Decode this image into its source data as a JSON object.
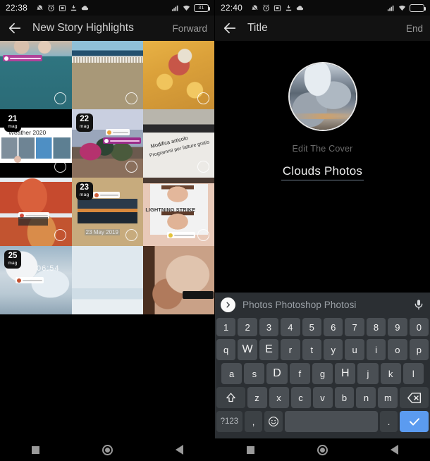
{
  "left": {
    "status": {
      "time": "22:38",
      "battery_text": "31",
      "icons": [
        "alarm-muted-icon",
        "alarm-icon",
        "screenshot-icon",
        "download-icon",
        "cloud-icon"
      ],
      "right_icons": [
        "signal-icon",
        "wifi-icon",
        "battery-icon"
      ]
    },
    "appbar": {
      "back": "back-arrow-icon",
      "title": "New Story Highlights",
      "action": "Forward"
    },
    "grid": [
      {
        "name": "cell-person-mask",
        "badge": null,
        "theme": "teal",
        "chip_text": "ROSSANO CALABRO",
        "selected": false
      },
      {
        "name": "cell-beach",
        "badge": null,
        "theme": "beach",
        "selected": false
      },
      {
        "name": "cell-food-meat",
        "badge": null,
        "theme": "food1",
        "selected": false
      },
      {
        "name": "cell-weather-2020",
        "badge": {
          "day": "21",
          "month": "mag"
        },
        "theme": "weather",
        "overlay": "Weather 2020",
        "selected": false
      },
      {
        "name": "cell-tree-street",
        "badge": {
          "day": "22",
          "month": "mag"
        },
        "theme": "tree",
        "selected": false
      },
      {
        "name": "cell-article-edit",
        "badge": null,
        "theme": "article",
        "overlay": "Modifica articolo",
        "overlay2": "Programmi per fatture gratis",
        "selected": false
      },
      {
        "name": "cell-pasta",
        "badge": null,
        "theme": "pasta",
        "selected": false
      },
      {
        "name": "cell-sunset-boat",
        "badge": {
          "day": "23",
          "month": "mag"
        },
        "theme": "sunset",
        "overlay": "23 May 2019",
        "selected": false
      },
      {
        "name": "cell-lightning-meme",
        "badge": null,
        "theme": "meme",
        "overlay": "LIGHTNING STRIKE",
        "selected": false
      },
      {
        "name": "cell-clouds-time",
        "badge": {
          "day": "25",
          "month": "mag"
        },
        "theme": "clouds",
        "overlay": "06:54",
        "selected": false
      },
      {
        "name": "cell-sky-plain",
        "badge": null,
        "theme": "sky",
        "selected": false
      },
      {
        "name": "cell-texture",
        "badge": null,
        "theme": "texture",
        "selected": false
      }
    ],
    "nav": {
      "recents": "square-icon",
      "home": "circle-icon",
      "back": "triangle-back-icon"
    }
  },
  "right": {
    "status": {
      "time": "22:40",
      "battery_text": "",
      "icons": [
        "alarm-muted-icon",
        "alarm-icon",
        "screenshot-icon",
        "download-icon",
        "cloud-icon"
      ],
      "right_icons": [
        "signal-icon",
        "wifi-icon",
        "battery-icon"
      ]
    },
    "appbar": {
      "back": "back-arrow-icon",
      "title": "Title",
      "action": "End"
    },
    "cover": {
      "edit_label": "Edit The Cover",
      "title_value": "Clouds Photos"
    },
    "keyboard": {
      "suggestions": "Photos Photoshop Photosi",
      "more_icon": "chevron-right-icon",
      "mic_icon": "microphone-icon",
      "row_numbers": [
        "1",
        "2",
        "3",
        "4",
        "5",
        "6",
        "7",
        "8",
        "9",
        "0"
      ],
      "row1": [
        "q",
        "W",
        "E",
        "r",
        "t",
        "y",
        "u",
        "i",
        "o",
        "p"
      ],
      "row2": [
        "a",
        "s",
        "D",
        "f",
        "g",
        "H",
        "j",
        "k",
        "l"
      ],
      "row3_shift": "shift-icon",
      "row3": [
        "z",
        "x",
        "c",
        "v",
        "b",
        "n",
        "m"
      ],
      "row3_backspace": "backspace-icon",
      "bottom": {
        "symbols": "?123",
        "comma": ",",
        "emoji": "emoji-icon",
        "space": "",
        "period": ".",
        "enter": "check-icon"
      },
      "accent": "#5b9bf0"
    },
    "nav": {
      "recents": "square-icon",
      "home": "circle-icon",
      "back": "triangle-back-icon"
    }
  }
}
